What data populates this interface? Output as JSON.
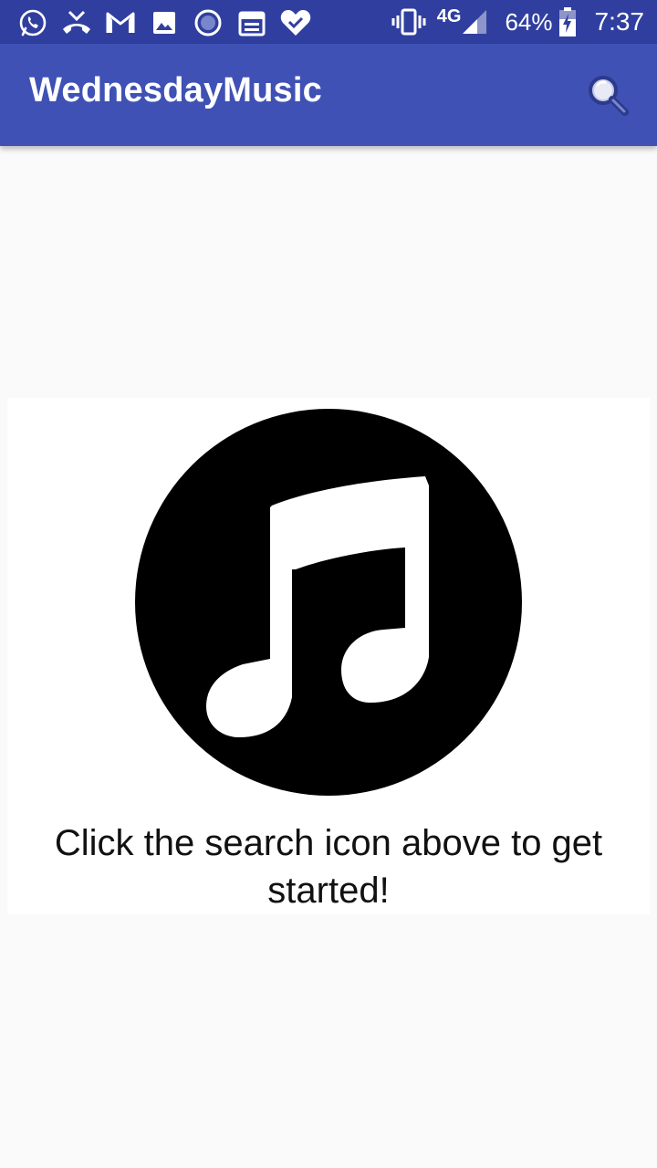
{
  "status_bar": {
    "network": "4G",
    "battery": "64%",
    "time": "7:37",
    "left_icons": [
      "whatsapp-icon",
      "missed-call-icon",
      "gmail-icon",
      "gallery-icon",
      "record-icon",
      "calendar-icon",
      "heart-check-icon"
    ],
    "right_icons": [
      "vibrate-icon",
      "signal-icon",
      "battery-charging-icon"
    ]
  },
  "app_bar": {
    "title": "WednesdayMusic",
    "actions": [
      "search-icon"
    ]
  },
  "empty_state": {
    "icon": "music-note-icon",
    "message": "Click the search icon above to get started!"
  },
  "colors": {
    "status_bar": "#303f9f",
    "primary": "#3f51b5",
    "background": "#fafafa",
    "card": "#ffffff",
    "text": "#111111"
  }
}
